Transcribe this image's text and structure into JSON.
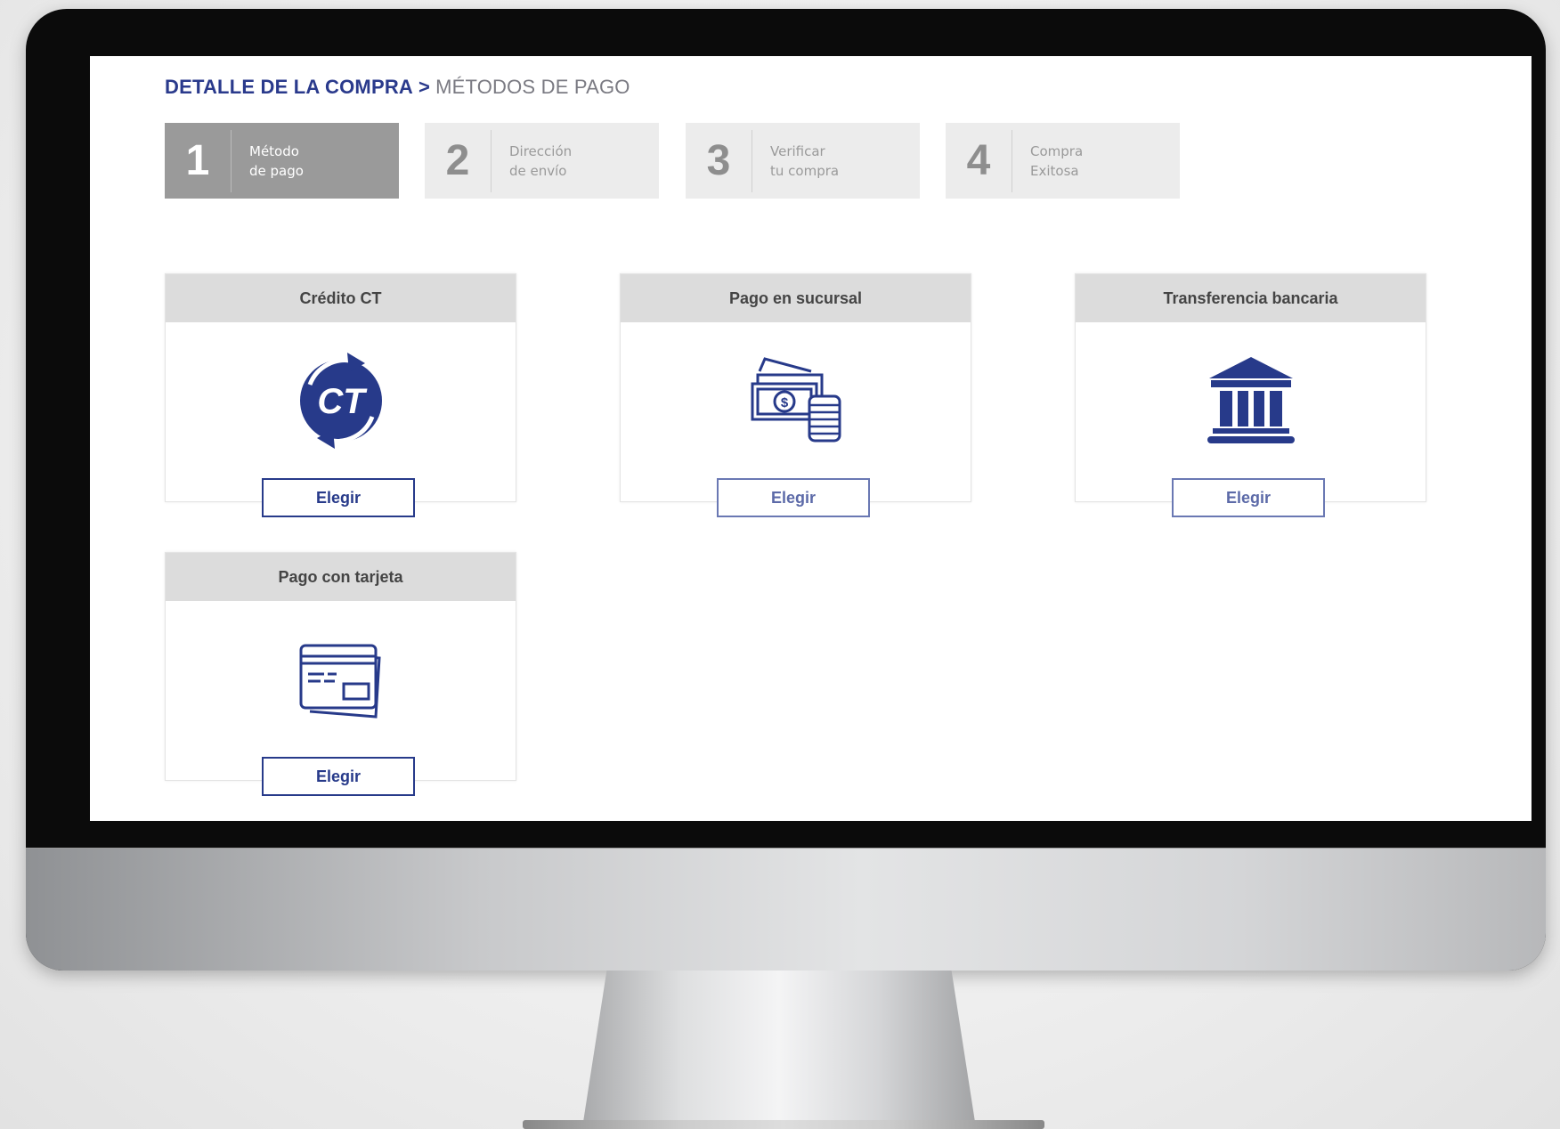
{
  "breadcrumb": {
    "detail": "DETALLE DE LA COMPRA",
    "separator": ">",
    "current": "MÉTODOS DE PAGO"
  },
  "steps": [
    {
      "number": "1",
      "line1": "Método",
      "line2": "de pago",
      "active": true
    },
    {
      "number": "2",
      "line1": "Dirección",
      "line2": "de envío",
      "active": false
    },
    {
      "number": "3",
      "line1": "Verificar",
      "line2": "tu compra",
      "active": false
    },
    {
      "number": "4",
      "line1": "Compra",
      "line2": "Exitosa",
      "active": false
    }
  ],
  "payment_methods": [
    {
      "title": "Crédito CT",
      "icon": "ct-logo-icon",
      "button": "Elegir"
    },
    {
      "title": "Pago en sucursal",
      "icon": "cash-coins-icon",
      "button": "Elegir"
    },
    {
      "title": "Transferencia bancaria",
      "icon": "bank-icon",
      "button": "Elegir"
    },
    {
      "title": "Pago con tarjeta",
      "icon": "credit-card-icon",
      "button": "Elegir"
    }
  ],
  "ct_logo_text": "CT",
  "colors": {
    "brand_blue": "#273a8a",
    "active_step": "#9a9a9a",
    "inactive_step": "#ececec",
    "card_header": "#dcdcdc"
  }
}
